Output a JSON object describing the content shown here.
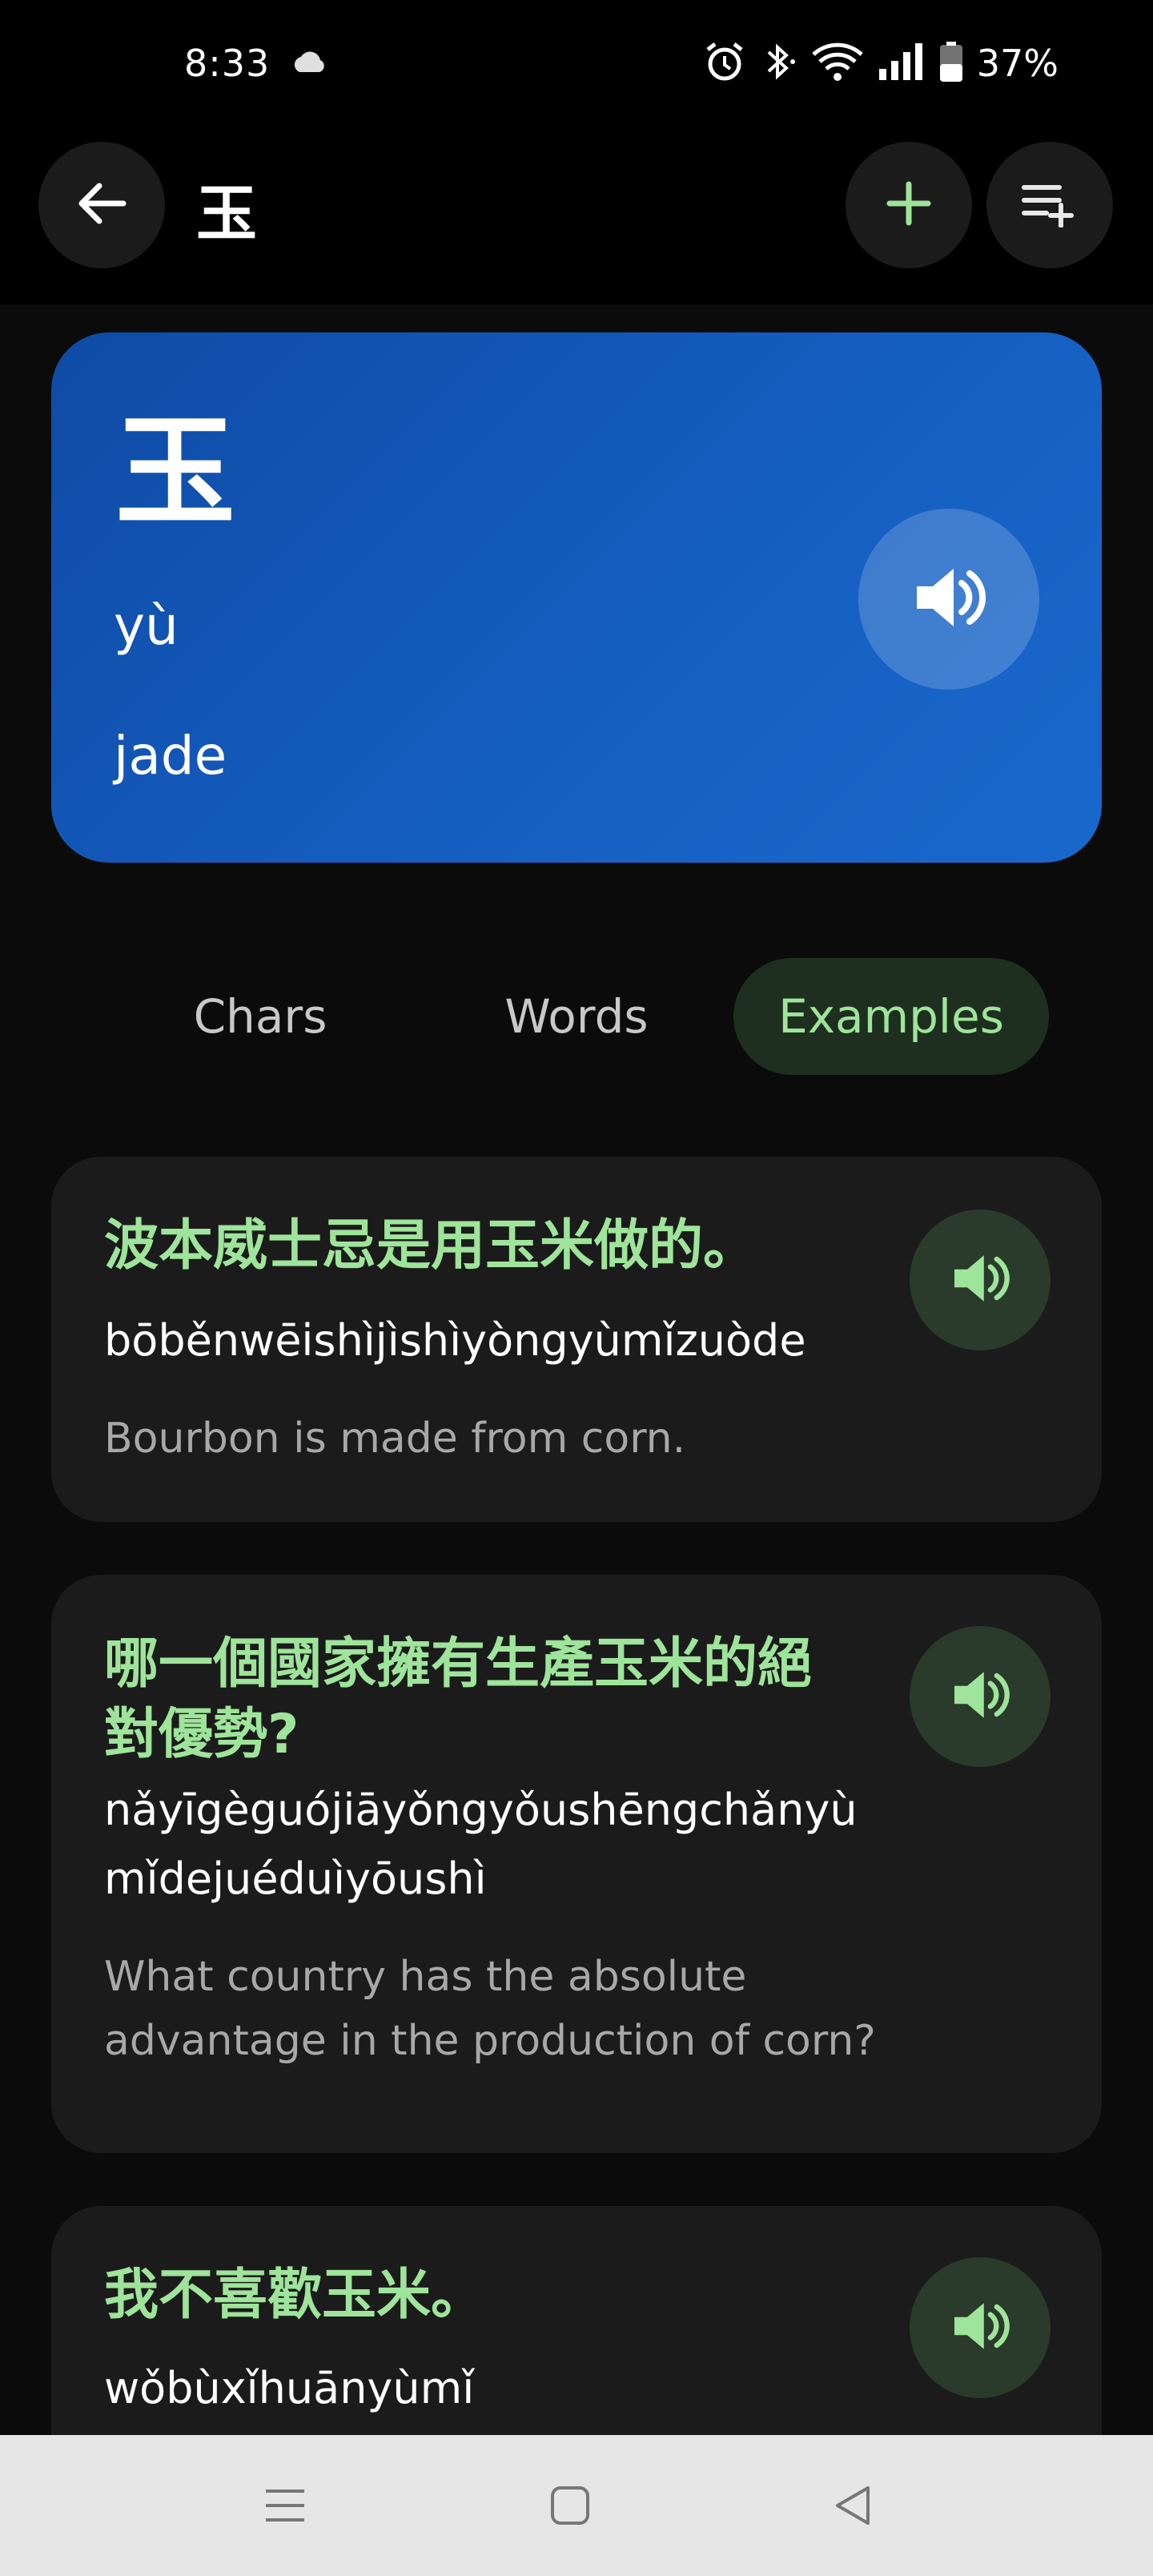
{
  "status_bar": {
    "time": "8:33",
    "battery": "37%",
    "icons": [
      "cloud-icon",
      "alarm-icon",
      "bluetooth-icon",
      "wifi-icon",
      "signal-icon",
      "battery-icon"
    ]
  },
  "app_bar": {
    "title": "玉",
    "icons": [
      "back-arrow-icon",
      "plus-icon",
      "playlist-add-icon"
    ],
    "accent": "#9ee49a"
  },
  "hero": {
    "character": "玉",
    "pinyin": "yù",
    "meaning": "jade",
    "background": "#1560c3"
  },
  "tabs": [
    {
      "label": "Chars",
      "selected": false
    },
    {
      "label": "Words",
      "selected": false
    },
    {
      "label": "Examples",
      "selected": true
    }
  ],
  "examples": [
    {
      "chinese": "波本威士忌是用玉米做的。",
      "pinyin": "bōběnwēishìjìshìyòngyùmǐzuòde",
      "english": "Bourbon is made from corn."
    },
    {
      "chinese": "哪一個國家擁有生產玉米的絕對優勢?",
      "chinese_line1": "哪一個國家擁有生產玉米的絕",
      "chinese_line2": "對優勢?",
      "pinyin": "nǎyīgèguójiāyǒngyǒushēngchǎnyùmǐdejuéduìyōushì",
      "pinyin_line1": "nǎyīgèguójiāyǒngyǒushēngchǎnyù",
      "pinyin_line2": "mǐdejuéduìyōushì",
      "english": "What country has the absolute advantage in the production of corn?",
      "english_line1": "What country has the absolute",
      "english_line2": "advantage in the production of corn?"
    },
    {
      "chinese": "我不喜歡玉米。",
      "pinyin": "wǒbùxǐhuānyùmǐ",
      "english": ""
    }
  ],
  "nav_bar": {
    "icons": [
      "menu-icon",
      "home-square-icon",
      "back-triangle-icon"
    ]
  }
}
